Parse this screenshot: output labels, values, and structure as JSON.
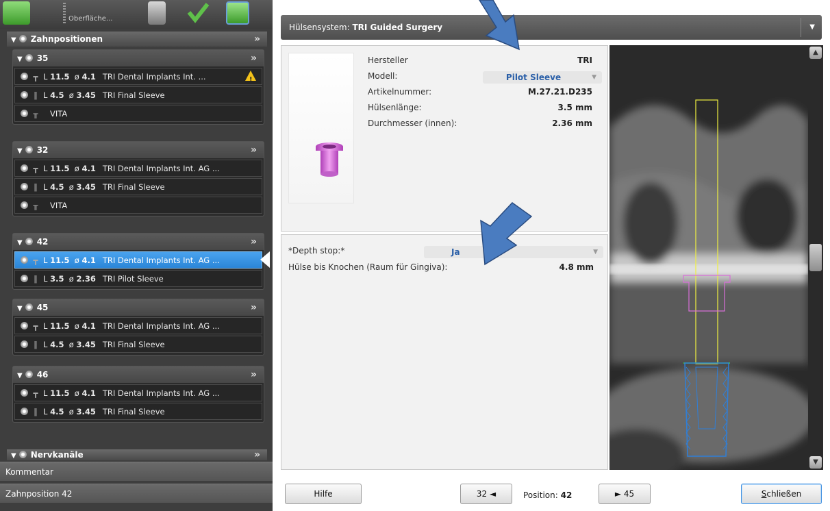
{
  "toolbar": {
    "label": "Oberfläche..."
  },
  "left": {
    "section_title": "Zahnpositionen",
    "groups": [
      {
        "number": "35",
        "rows": [
          {
            "len": "11.5",
            "dia": "4.1",
            "name": "TRI Dental Implants Int. ...",
            "warning": true
          },
          {
            "len": "4.5",
            "dia": "3.45",
            "name": "TRI Final Sleeve"
          },
          {
            "name": "VITA"
          }
        ]
      },
      {
        "number": "32",
        "rows": [
          {
            "len": "11.5",
            "dia": "4.1",
            "name": "TRI Dental Implants Int. AG ..."
          },
          {
            "len": "4.5",
            "dia": "3.45",
            "name": "TRI Final Sleeve"
          },
          {
            "name": "VITA"
          }
        ]
      },
      {
        "number": "42",
        "rows": [
          {
            "len": "11.5",
            "dia": "4.1",
            "name": "TRI Dental Implants Int. AG ...",
            "selected": true
          },
          {
            "len": "3.5",
            "dia": "2.36",
            "name": "TRI Pilot Sleeve"
          }
        ]
      },
      {
        "number": "45",
        "rows": [
          {
            "len": "11.5",
            "dia": "4.1",
            "name": "TRI Dental Implants Int. AG ..."
          },
          {
            "len": "4.5",
            "dia": "3.45",
            "name": "TRI Final Sleeve"
          }
        ]
      },
      {
        "number": "46",
        "rows": [
          {
            "len": "11.5",
            "dia": "4.1",
            "name": "TRI Dental Implants Int. AG ..."
          },
          {
            "len": "4.5",
            "dia": "3.45",
            "name": "TRI Final Sleeve"
          }
        ]
      }
    ],
    "nerve_section": "Nervkanäle",
    "comment_label": "Kommentar",
    "position_label": "Zahnposition 42",
    "warning_glyph": "!",
    "len_prefix": "L",
    "dia_prefix": "ø"
  },
  "dialog": {
    "header_label": "Hülsensystem:",
    "header_value": "TRI Guided Surgery",
    "sleeve": {
      "manufacturer_label": "Hersteller",
      "manufacturer_value": "TRI",
      "model_label": "Modell:",
      "model_value": "Pilot Sleeve",
      "article_label": "Artikelnummer:",
      "article_value": "M.27.21.D235",
      "length_label": "Hülsenlänge:",
      "length_value": "3.5 mm",
      "diameter_label": "Durchmesser (innen):",
      "diameter_value": "2.36 mm"
    },
    "depth": {
      "stop_label": "*Depth stop:*",
      "stop_value": "Ja",
      "gap_label": "Hülse bis Knochen (Raum für Gingiva):",
      "gap_value": "4.8 mm"
    },
    "footer": {
      "help": "Hilfe",
      "prev": "32 ◄",
      "position_label": "Position:",
      "position_value": "42",
      "next": "► 45",
      "close_first": "S",
      "close_rest": "chließen"
    }
  },
  "colors": {
    "selection": "#2b86d8",
    "sleeve": "#d86fd8",
    "implant": "#2f7fd8",
    "guide": "#f0f040",
    "arrow": "#4a7cc0"
  }
}
